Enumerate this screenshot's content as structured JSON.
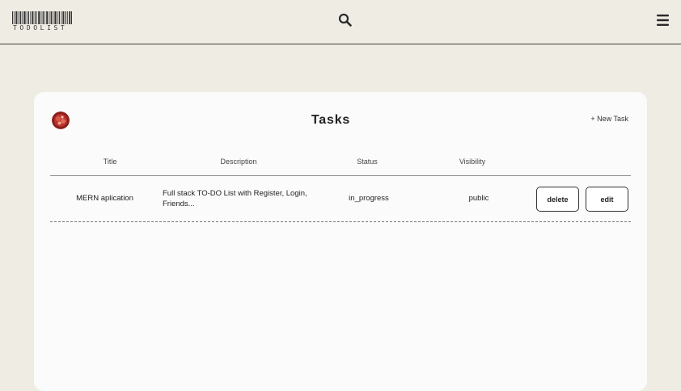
{
  "header": {
    "logo_text": "TODOLIST",
    "search_icon": "search-icon",
    "menu_icon": "hamburger-menu-icon"
  },
  "tasks_card": {
    "title": "Tasks",
    "new_task_label": "+ New Task",
    "columns": [
      "Title",
      "Description",
      "Status",
      "Visibility"
    ],
    "rows": [
      {
        "title": "MERN aplication",
        "description": "Full stack TO-DO List with Register, Login, Friends...",
        "status": "in_progress",
        "visibility": "public",
        "delete_label": "delete",
        "edit_label": "edit"
      }
    ]
  },
  "colors": {
    "page_background": "#efece4",
    "card_background": "#fbfbfb",
    "border": "#333333"
  }
}
